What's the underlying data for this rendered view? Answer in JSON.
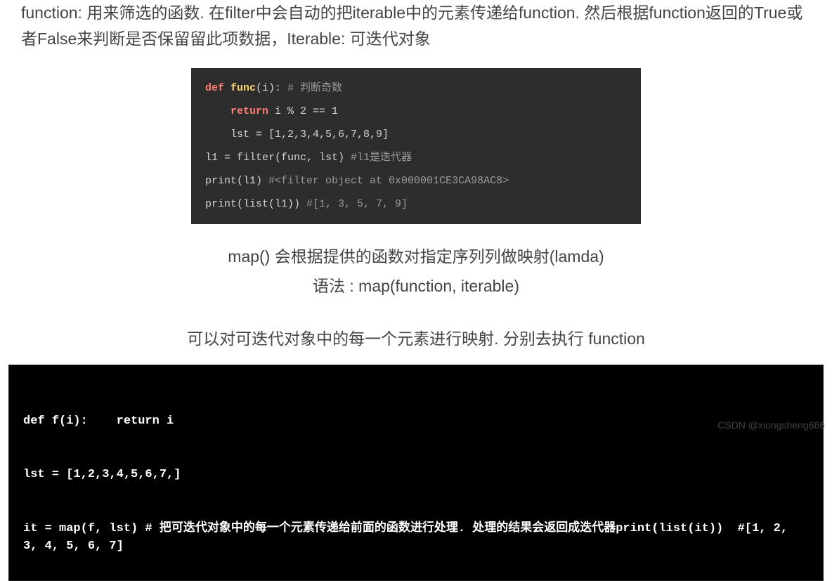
{
  "intro_para": "function: 用来筛选的函数. 在filter中会自动的把iterable中的元素传递给function. 然后根据function返回的True或者False来判断是否保留留此项数据，Iterable: 可迭代对象",
  "code1": {
    "l1_def": "def ",
    "l1_fn": "func",
    "l1_args": "(i):    ",
    "l1_comment": "# 判断奇数",
    "l2_ret": "return ",
    "l2_expr": "i % 2 == 1",
    "l3": "lst = [1,2,3,4,5,6,7,8,9]",
    "l4_code": "l1 = filter(func, lst)  ",
    "l4_comment": "#l1是迭代器",
    "l5_code": "print(l1)  ",
    "l5_comment": "#<filter object at 0x000001CE3CA98AC8>",
    "l6_code": "print(list(l1))  ",
    "l6_comment": "#[1, 3, 5, 7, 9]"
  },
  "map_desc_line1": "map() 会根据提供的函数对指定序列列做映射(lamda)",
  "map_desc_line2": "语法 : map(function, iterable)",
  "map_desc_line3": "可以对可迭代对象中的每一个元素进行映射. 分别去执行 function",
  "code2": {
    "l1": "def f(i):    return i",
    "l2": "lst = [1,2,3,4,5,6,7,]",
    "l3": "it = map(f, lst) # 把可迭代对象中的每一个元素传递给前面的函数进行处理. 处理的结果会返回成迭代器print(list(it))  #[1, 2, 3, 4, 5, 6, 7]"
  },
  "watermark": "CSDN @xiongsheng666"
}
